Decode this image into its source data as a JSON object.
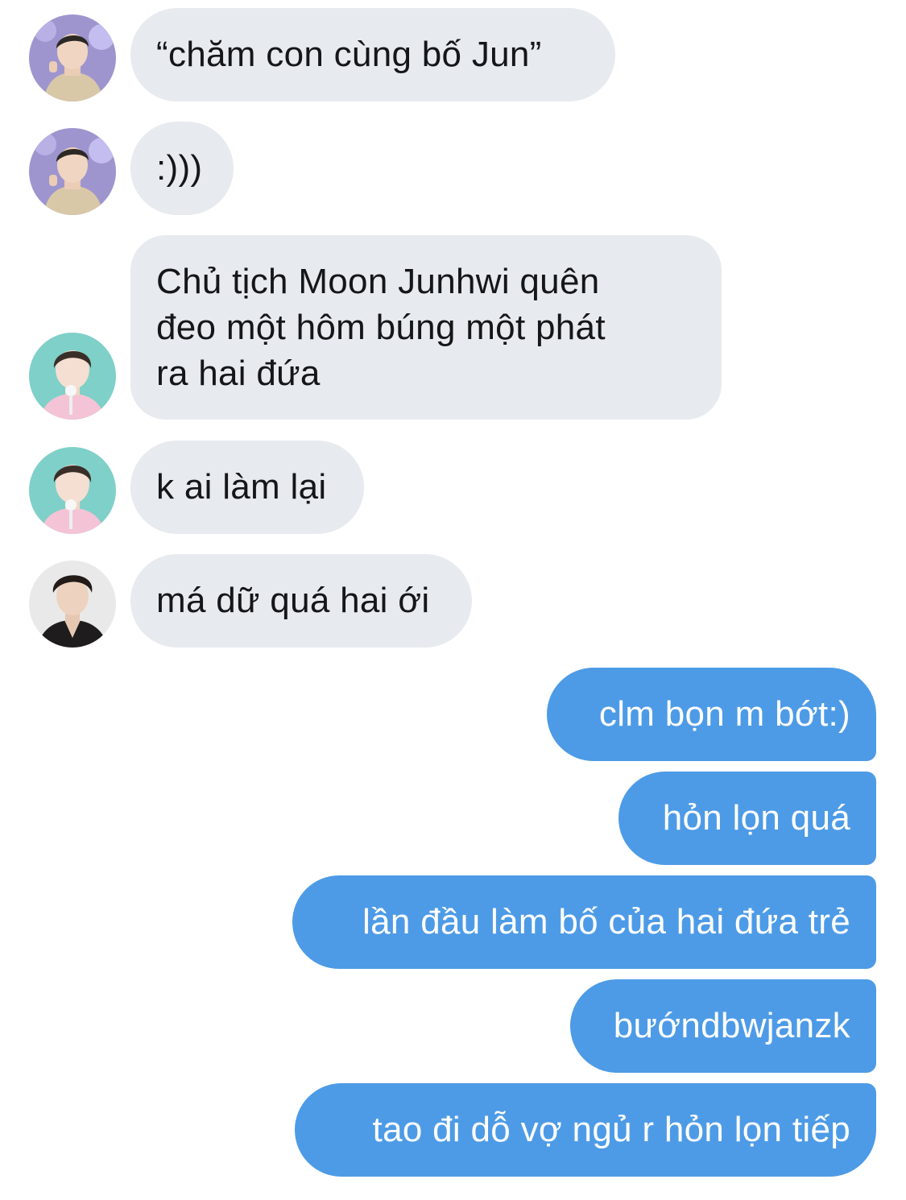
{
  "messages": [
    {
      "from": "contact",
      "avatar": "contact-a",
      "lines": [
        "“chăm con cùng bố Jun”"
      ]
    },
    {
      "from": "contact",
      "avatar": "contact-a",
      "lines": [
        ":)))"
      ]
    },
    {
      "from": "contact",
      "avatar": "contact-b",
      "lines": [
        "Chủ tịch Moon Junhwi quên",
        "đeo một hôm búng một phát",
        "ra hai đứa"
      ]
    },
    {
      "from": "contact",
      "avatar": "contact-b",
      "lines": [
        "k ai làm lại"
      ]
    },
    {
      "from": "contact",
      "avatar": "contact-c",
      "lines": [
        "má dữ quá hai ới"
      ]
    },
    {
      "from": "self",
      "lines": [
        "clm bọn m bớt:)"
      ]
    },
    {
      "from": "self",
      "lines": [
        "hỏn lọn quá"
      ]
    },
    {
      "from": "self",
      "lines": [
        "lần đầu làm bố của hai đứa trẻ"
      ]
    },
    {
      "from": "self",
      "lines": [
        "bướndbwjanzk"
      ]
    },
    {
      "from": "self",
      "lines": [
        "tao đi dỗ vợ ngủ r hỏn lọn tiếp"
      ]
    }
  ],
  "colors": {
    "incoming_bubble": "#e7eaee",
    "incoming_text": "#141619",
    "outgoing_bubble": "#4d9be6",
    "outgoing_text": "#ffffff"
  }
}
